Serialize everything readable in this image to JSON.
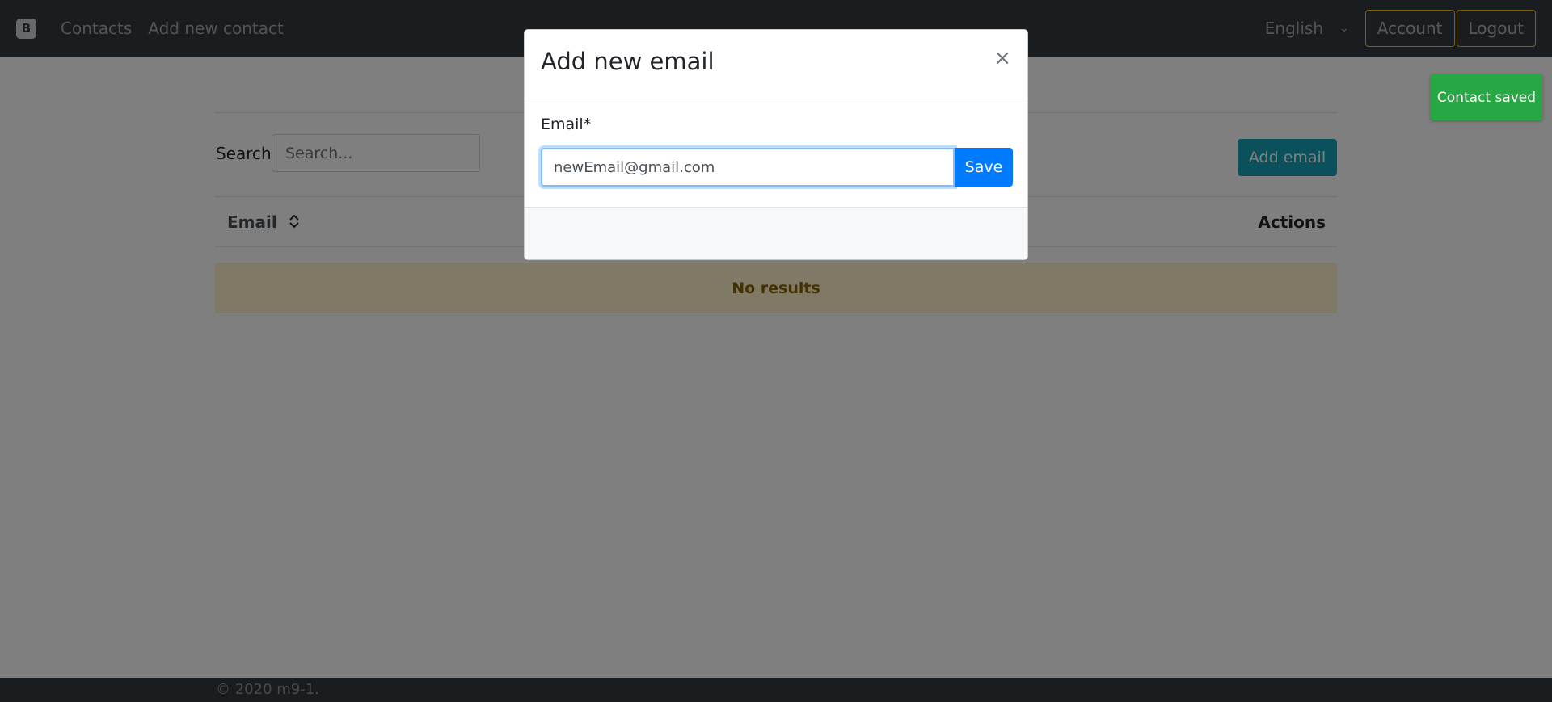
{
  "navbar": {
    "brand_letter": "B",
    "links": [
      "Contacts",
      "Add new contact"
    ],
    "language": "English",
    "account_label": "Account",
    "logout_label": "Logout"
  },
  "main": {
    "search_label": "Search",
    "search_placeholder": "Search...",
    "add_email_label": "Add email",
    "table": {
      "columns": [
        "Email",
        "Actions"
      ],
      "empty_text": "No results"
    }
  },
  "footer": {
    "text": "© 2020 m9-1."
  },
  "modal": {
    "title": "Add new email",
    "close_symbol": "×",
    "email_label": "Email*",
    "email_value": "newEmail@gmail.com",
    "save_label": "Save"
  },
  "toast": {
    "text": "Contact saved",
    "color": "#28a745"
  },
  "colors": {
    "navbar": "#343a40",
    "primary": "#007bff",
    "info": "#17a2b8",
    "warning_outline": "#ffc107",
    "alert_bg": "#fff3cd"
  }
}
